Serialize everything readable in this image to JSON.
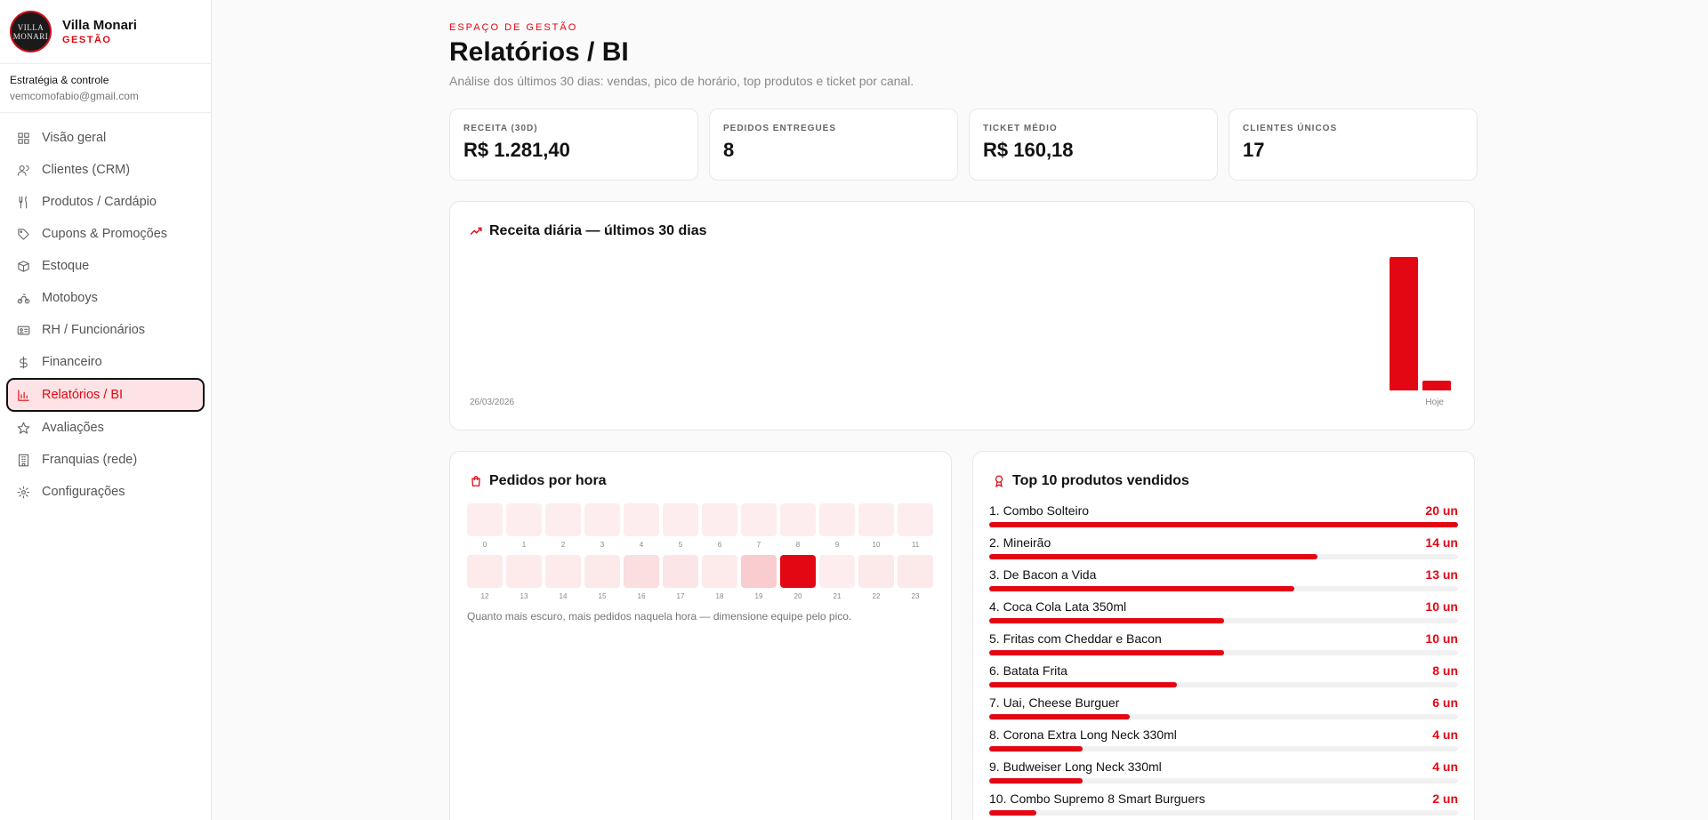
{
  "brand": {
    "name": "Villa Monari",
    "sub": "GESTÃO",
    "logo_line1": "VILLA",
    "logo_line2": "MONARI"
  },
  "user": {
    "title": "Estratégia & controle",
    "email": "vemcomofabio@gmail.com"
  },
  "nav": [
    {
      "label": "Visão geral",
      "icon": "grid-icon"
    },
    {
      "label": "Clientes (CRM)",
      "icon": "users-icon"
    },
    {
      "label": "Produtos / Cardápio",
      "icon": "utensils-icon"
    },
    {
      "label": "Cupons & Promoções",
      "icon": "tag-icon"
    },
    {
      "label": "Estoque",
      "icon": "box-icon"
    },
    {
      "label": "Motoboys",
      "icon": "bike-icon"
    },
    {
      "label": "RH / Funcionários",
      "icon": "id-card-icon"
    },
    {
      "label": "Financeiro",
      "icon": "dollar-icon"
    },
    {
      "label": "Relatórios / BI",
      "icon": "bar-chart-icon",
      "active": true
    },
    {
      "label": "Avaliações",
      "icon": "star-icon"
    },
    {
      "label": "Franquias (rede)",
      "icon": "building-icon"
    },
    {
      "label": "Configurações",
      "icon": "gear-icon"
    }
  ],
  "header": {
    "eyebrow": "ESPAÇO DE GESTÃO",
    "title": "Relatórios / BI",
    "subtitle": "Análise dos últimos 30 dias: vendas, pico de horário, top produtos e ticket por canal."
  },
  "kpis": [
    {
      "label": "RECEITA (30D)",
      "value": "R$ 1.281,40"
    },
    {
      "label": "PEDIDOS ENTREGUES",
      "value": "8"
    },
    {
      "label": "TICKET MÉDIO",
      "value": "R$ 160,18"
    },
    {
      "label": "CLIENTES ÚNICOS",
      "value": "17"
    }
  ],
  "revenue_chart": {
    "title": "Receita diária — últimos 30 dias",
    "start_label": "26/03/2026",
    "end_label": "Hoje"
  },
  "chart_data": {
    "type": "bar",
    "title": "Receita diária — últimos 30 dias",
    "x_range": [
      "26/03/2026",
      "Hoje"
    ],
    "values_relative": [
      0,
      0,
      0,
      0,
      0,
      0,
      0,
      0,
      0,
      0,
      0,
      0,
      0,
      0,
      0,
      0,
      0,
      0,
      0,
      0,
      0,
      0,
      0,
      0,
      0,
      0,
      0,
      0,
      1.0,
      0.07
    ],
    "accent_color": "#e30613"
  },
  "hours": {
    "title": "Pedidos por hora",
    "row1": [
      0,
      1,
      2,
      3,
      4,
      5,
      6,
      7,
      8,
      9,
      10,
      11
    ],
    "row2": [
      12,
      13,
      14,
      15,
      16,
      17,
      18,
      19,
      20,
      21,
      22,
      23
    ],
    "intensity": [
      0.03,
      0.03,
      0.03,
      0.03,
      0.03,
      0.03,
      0.03,
      0.03,
      0.03,
      0.03,
      0.03,
      0.03,
      0.05,
      0.05,
      0.05,
      0.06,
      0.12,
      0.08,
      0.04,
      0.22,
      1.0,
      0.03,
      0.06,
      0.06
    ],
    "note": "Quanto mais escuro, mais pedidos naquela hora — dimensione equipe pelo pico."
  },
  "top_products": {
    "title": "Top 10 produtos vendidos",
    "items": [
      {
        "name": "1. Combo Solteiro",
        "qty": "20 un",
        "value": 20
      },
      {
        "name": "2. Mineirão",
        "qty": "14 un",
        "value": 14
      },
      {
        "name": "3. De Bacon a Vida",
        "qty": "13 un",
        "value": 13
      },
      {
        "name": "4. Coca Cola Lata 350ml",
        "qty": "10 un",
        "value": 10
      },
      {
        "name": "5. Fritas com Cheddar e Bacon",
        "qty": "10 un",
        "value": 10
      },
      {
        "name": "6. Batata Frita",
        "qty": "8 un",
        "value": 8
      },
      {
        "name": "7. Uai, Cheese Burguer",
        "qty": "6 un",
        "value": 6
      },
      {
        "name": "8. Corona Extra Long Neck 330ml",
        "qty": "4 un",
        "value": 4
      },
      {
        "name": "9. Budweiser Long Neck 330ml",
        "qty": "4 un",
        "value": 4
      },
      {
        "name": "10. Combo Supremo 8 Smart Burguers",
        "qty": "2 un",
        "value": 2
      }
    ]
  }
}
